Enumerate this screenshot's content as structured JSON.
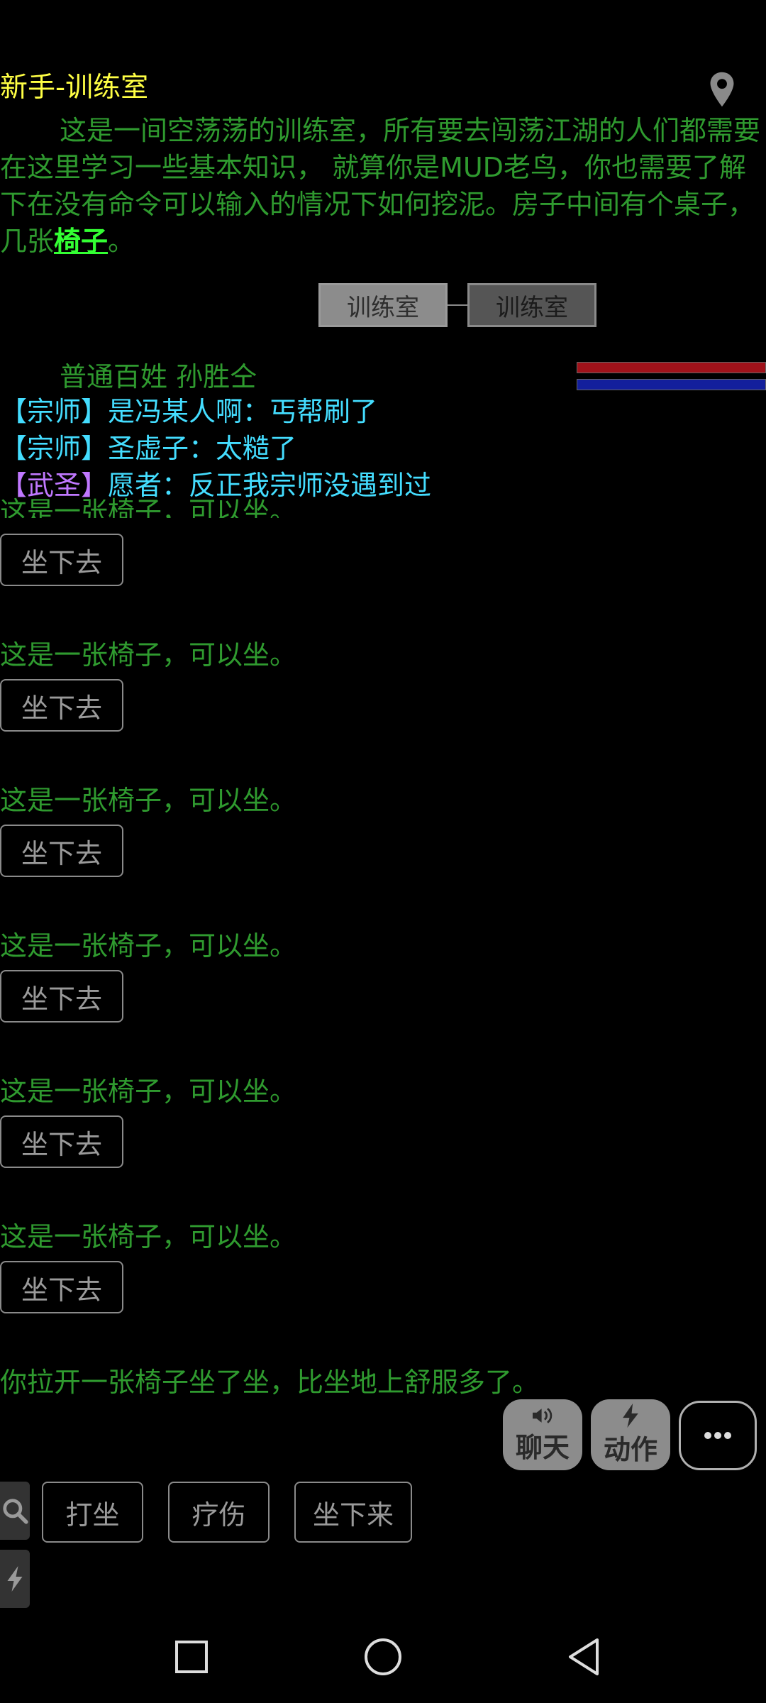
{
  "room": {
    "title": "新手-训练室",
    "description_line1": "这是一间空荡荡的训练室，所有要去闯荡江湖的人们都需要在这里学习一些基本知识， 就算你是MUD老鸟，你也需要了解下在没有命令可以输入的情况下如何挖泥。房子中间有个桌子，几张",
    "description_link": "椅子",
    "description_end": "。"
  },
  "map": {
    "current": "训练室",
    "neighbor": "训练室"
  },
  "npc": {
    "label": "普通百姓 孙胜仝"
  },
  "status_colors": {
    "hp": "#a0121a",
    "mp": "#131f9c"
  },
  "chat": [
    {
      "tag": "【宗师】",
      "text": "是冯某人啊：丐帮刷了"
    },
    {
      "tag": "【宗师】",
      "text": "圣虚子：太糙了"
    },
    {
      "tag": "【武圣】",
      "text": "愿者：反正我宗师没遇到过"
    }
  ],
  "chairs": {
    "partial_text": "这是一张椅子，可以坐。",
    "items": [
      {
        "text": "这是一张椅子，可以坐。",
        "button": "坐下去"
      },
      {
        "text": "这是一张椅子，可以坐。",
        "button": "坐下去"
      },
      {
        "text": "这是一张椅子，可以坐。",
        "button": "坐下去"
      },
      {
        "text": "这是一张椅子，可以坐。",
        "button": "坐下去"
      },
      {
        "text": "这是一张椅子，可以坐。",
        "button": "坐下去"
      }
    ],
    "first_button": "坐下去"
  },
  "result_text": "你拉开一张椅子坐了坐，比坐地上舒服多了。",
  "toolbar": {
    "chat_label": "聊天",
    "action_label": "动作",
    "more_icon": "ellipsis-icon"
  },
  "skills": [
    "打坐",
    "疗伤",
    "坐下来"
  ],
  "icons": {
    "location": "location-pin-icon",
    "search": "search-icon",
    "bolt": "lightning-icon",
    "speaker": "speaker-icon"
  }
}
